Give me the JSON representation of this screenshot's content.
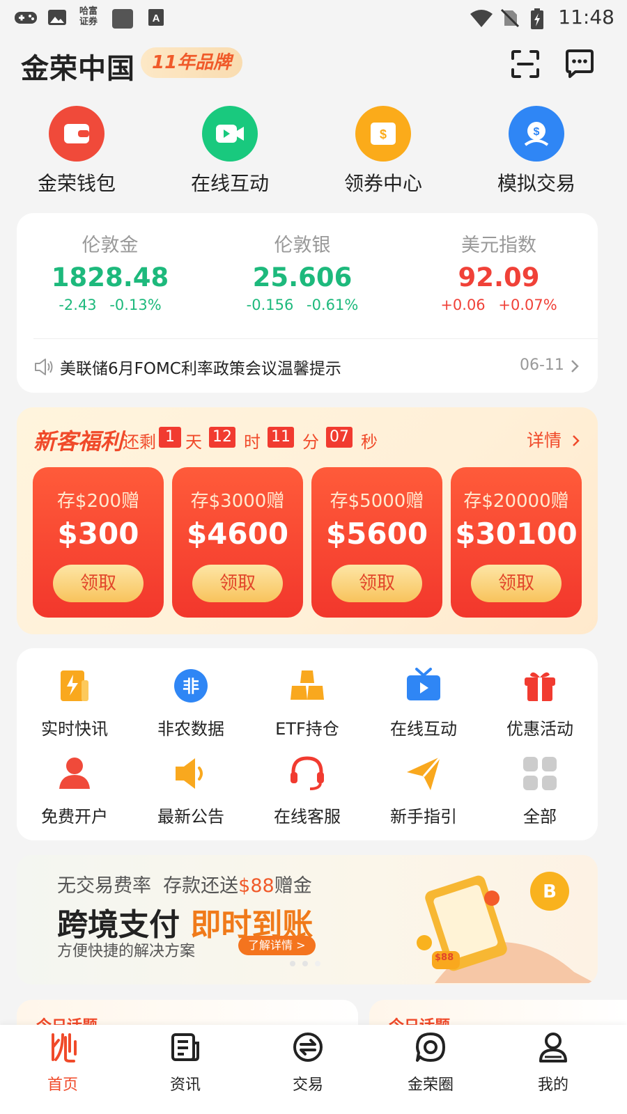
{
  "status_bar": {
    "time": "11:48",
    "app_badge": "哈富\n证券",
    "icons": [
      "gamepad-icon",
      "image-icon",
      "broker-app-icon",
      "clipboard-icon",
      "font-a-icon",
      "wifi-icon",
      "no-sim-icon",
      "battery-charging-icon"
    ]
  },
  "header": {
    "title": "金荣中国",
    "badge": "11年品牌",
    "actions": [
      "scan-icon",
      "message-icon"
    ]
  },
  "quick_entries": [
    {
      "label": "金荣钱包",
      "icon": "wallet-icon",
      "color": "#f04a3a"
    },
    {
      "label": "在线互动",
      "icon": "video-icon",
      "color": "#19c97e"
    },
    {
      "label": "领券中心",
      "icon": "coupon-icon",
      "color": "#fbab1a"
    },
    {
      "label": "模拟交易",
      "icon": "dollar-person-icon",
      "color": "#2f86f5"
    }
  ],
  "quotes": [
    {
      "name": "伦敦金",
      "price": "1828.48",
      "change": "-2.43",
      "percent": "-0.13%",
      "trend": "down"
    },
    {
      "name": "伦敦银",
      "price": "25.606",
      "change": "-0.156",
      "percent": "-0.61%",
      "trend": "down"
    },
    {
      "name": "美元指数",
      "price": "92.09",
      "change": "+0.06",
      "percent": "+0.07%",
      "trend": "up"
    }
  ],
  "notice": {
    "text": "美联储6月FOMC利率政策会议温馨提示",
    "date": "06-11"
  },
  "promo": {
    "title": "新客福利",
    "remaining": "还剩",
    "countdown": {
      "days": "1",
      "day_unit": "天",
      "hours": "12",
      "hour_unit": "时",
      "minutes": "11",
      "minute_unit": "分",
      "seconds": "07",
      "second_unit": "秒"
    },
    "detail_label": "详情",
    "coupons": [
      {
        "condition": "存$200赠",
        "amount": "$300",
        "button": "领取"
      },
      {
        "condition": "存$3000赠",
        "amount": "$4600",
        "button": "领取"
      },
      {
        "condition": "存$5000赠",
        "amount": "$5600",
        "button": "领取"
      },
      {
        "condition": "存$20000赠",
        "amount": "$30100",
        "button": "领取"
      }
    ]
  },
  "features": [
    {
      "label": "实时快讯",
      "icon": "flash-news-icon"
    },
    {
      "label": "非农数据",
      "icon": "nonfarm-icon"
    },
    {
      "label": "ETF持仓",
      "icon": "gold-bars-icon"
    },
    {
      "label": "在线互动",
      "icon": "tv-play-icon"
    },
    {
      "label": "优惠活动",
      "icon": "gift-icon"
    },
    {
      "label": "免费开户",
      "icon": "user-icon"
    },
    {
      "label": "最新公告",
      "icon": "speaker-icon"
    },
    {
      "label": "在线客服",
      "icon": "headset-icon"
    },
    {
      "label": "新手指引",
      "icon": "paper-plane-icon"
    },
    {
      "label": "全部",
      "icon": "grid-icon"
    }
  ],
  "banner": {
    "line1_a": "无交易费率",
    "line1_b": "存款还送",
    "line1_c": "$88",
    "line1_d": "赠金",
    "headline_a": "跨境支付",
    "headline_b": "即时到账",
    "sub": "方便快捷的解决方案",
    "cta": "了解详情 >",
    "coin_label": "$88"
  },
  "topics_peek": [
    "今日话题",
    "今日话题"
  ],
  "bottom_nav": [
    {
      "label": "首页",
      "icon": "home-logo-icon",
      "active": true
    },
    {
      "label": "资讯",
      "icon": "news-icon",
      "active": false
    },
    {
      "label": "交易",
      "icon": "exchange-icon",
      "active": false
    },
    {
      "label": "金荣圈",
      "icon": "community-icon",
      "active": false
    },
    {
      "label": "我的",
      "icon": "profile-icon",
      "active": false
    }
  ],
  "colors": {
    "accent": "#f04a2a",
    "down": "#1db97c",
    "up": "#f04138"
  }
}
